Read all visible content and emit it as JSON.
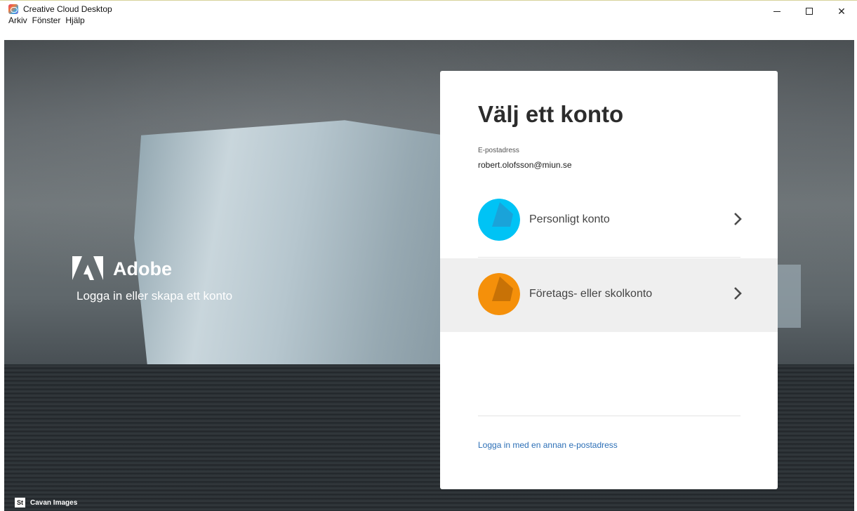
{
  "window": {
    "title": "Creative Cloud Desktop",
    "controls": {
      "minimize": "",
      "maximize": "",
      "close": "✕"
    }
  },
  "menu": [
    "Arkiv",
    "Fönster",
    "Hjälp"
  ],
  "branding": {
    "wordmark": "Adobe",
    "tagline": "Logga in eller skapa ett konto"
  },
  "photo_credit": {
    "badge": "St",
    "author": "Cavan Images"
  },
  "card": {
    "title": "Välj ett konto",
    "email_label": "E-postadress",
    "email_value": "robert.olofsson@miun.se",
    "accounts": [
      {
        "label": "Personligt konto",
        "avatar_color": "#00c3f5",
        "avatar_shape_color": "#1aa3d9",
        "selected": false
      },
      {
        "label": "Företags- eller skolkonto",
        "avatar_color": "#f5900a",
        "avatar_shape_color": "#c87206",
        "selected": true
      }
    ],
    "other_email_link": "Logga in med en annan e-postadress"
  },
  "colors": {
    "link": "#2c6fb6",
    "title_text": "#2c2c2c",
    "row_selected_bg": "#efefef"
  }
}
